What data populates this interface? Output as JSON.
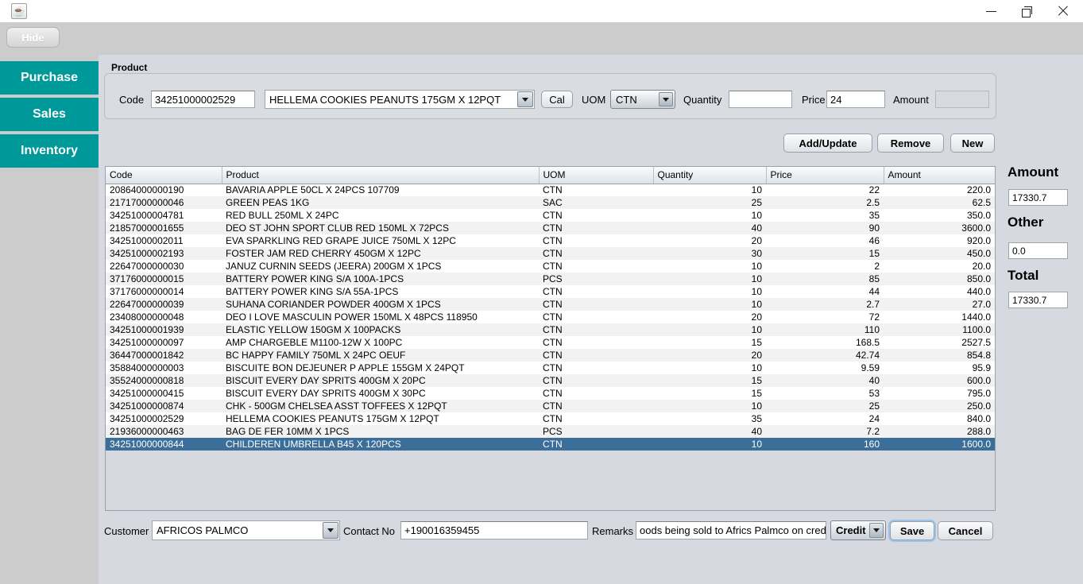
{
  "window": {
    "app_icon": "java-coffee-icon",
    "minimize": "minimize-icon",
    "maximize": "maximize-icon",
    "close": "close-icon"
  },
  "toolbar": {
    "hide_label": "Hide"
  },
  "sidebar": {
    "items": [
      {
        "label": "Purchase"
      },
      {
        "label": "Sales"
      },
      {
        "label": "Inventory"
      }
    ]
  },
  "product_panel": {
    "title": "Product",
    "code_label": "Code",
    "code_value": "34251000002529",
    "product_value": "HELLEMA COOKIES PEANUTS 175GM X 12PQT",
    "cal_label": "Cal",
    "uom_label": "UOM",
    "uom_value": "CTN",
    "quantity_label": "Quantity",
    "quantity_value": "",
    "price_label": "Price",
    "price_value": "24",
    "amount_label": "Amount",
    "amount_value": ""
  },
  "actions": {
    "add_update": "Add/Update",
    "remove": "Remove",
    "new": "New"
  },
  "table": {
    "columns": [
      "Code",
      "Product",
      "UOM",
      "Quantity",
      "Price",
      "Amount"
    ],
    "rows": [
      [
        "20864000000190",
        "BAVARIA APPLE 50CL X 24PCS 107709",
        "CTN",
        "10",
        "22",
        "220.0"
      ],
      [
        "21717000000046",
        "GREEN PEAS 1KG",
        "SAC",
        "25",
        "2.5",
        "62.5"
      ],
      [
        "34251000004781",
        "RED BULL 250ML X 24PC",
        "CTN",
        "10",
        "35",
        "350.0"
      ],
      [
        "21857000001655",
        "DEO ST JOHN SPORT CLUB RED 150ML X 72PCS",
        "CTN",
        "40",
        "90",
        "3600.0"
      ],
      [
        "34251000002011",
        "EVA SPARKLING RED GRAPE JUICE 750ML X 12PC",
        "CTN",
        "20",
        "46",
        "920.0"
      ],
      [
        "34251000002193",
        "FOSTER JAM RED CHERRY 450GM X 12PC",
        "CTN",
        "30",
        "15",
        "450.0"
      ],
      [
        "22647000000030",
        "JANUZ CURNIN SEEDS (JEERA) 200GM X 1PCS",
        "CTN",
        "10",
        "2",
        "20.0"
      ],
      [
        "37176000000015",
        "BATTERY POWER KING S/A 100A-1PCS",
        "PCS",
        "10",
        "85",
        "850.0"
      ],
      [
        "37176000000014",
        "BATTERY POWER KING S/A 55A-1PCS",
        "CTN",
        "10",
        "44",
        "440.0"
      ],
      [
        "22647000000039",
        "SUHANA CORIANDER POWDER 400GM X 1PCS",
        "CTN",
        "10",
        "2.7",
        "27.0"
      ],
      [
        "23408000000048",
        "DEO I LOVE MASCULIN POWER 150ML X 48PCS 118950",
        "CTN",
        "20",
        "72",
        "1440.0"
      ],
      [
        "34251000001939",
        "ELASTIC YELLOW 150GM X 100PACKS",
        "CTN",
        "10",
        "110",
        "1100.0"
      ],
      [
        "34251000000097",
        "AMP CHARGEBLE M1100-12W X 100PC",
        "CTN",
        "15",
        "168.5",
        "2527.5"
      ],
      [
        "36447000001842",
        "BC HAPPY FAMILY 750ML X 24PC OEUF",
        "CTN",
        "20",
        "42.74",
        "854.8"
      ],
      [
        "35884000000003",
        "BISCUITE BON DEJEUNER P APPLE 155GM X 24PQT",
        "CTN",
        "10",
        "9.59",
        "95.9"
      ],
      [
        "35524000000818",
        "BISCUIT EVERY DAY SPRITS 400GM X 20PC",
        "CTN",
        "15",
        "40",
        "600.0"
      ],
      [
        "34251000000415",
        "BISCUIT EVERY DAY SPRITS 400GM X 30PC",
        "CTN",
        "15",
        "53",
        "795.0"
      ],
      [
        "34251000000874",
        "CHK - 500GM CHELSEA ASST TOFFEES X 12PQT",
        "CTN",
        "10",
        "25",
        "250.0"
      ],
      [
        "34251000002529",
        "HELLEMA COOKIES PEANUTS 175GM X 12PQT",
        "CTN",
        "35",
        "24",
        "840.0"
      ],
      [
        "21936000000463",
        "BAG DE FER 10MM X 1PCS",
        "PCS",
        "40",
        "7.2",
        "288.0"
      ],
      [
        "34251000000844",
        "CHILDEREN UMBRELLA B45 X 120PCS",
        "CTN",
        "10",
        "160",
        "1600.0"
      ]
    ],
    "selected_row_index": 20
  },
  "totals": {
    "amount_label": "Amount",
    "amount_value": "17330.7",
    "other_label": "Other",
    "other_value": "0.0",
    "total_label": "Total",
    "total_value": "17330.7"
  },
  "footer": {
    "customer_label": "Customer",
    "customer_value": "AFRICOS PALMCO",
    "contact_label": "Contact No",
    "contact_value": "+190016359455",
    "remarks_label": "Remarks",
    "remarks_value": "oods being sold to Africs Palmco on credit",
    "payment_value": "Credit",
    "save_label": "Save",
    "cancel_label": "Cancel"
  },
  "colors": {
    "nav_teal": "#009999",
    "selection_blue": "#3b6e99",
    "panel_bg": "#d6dae0",
    "toolbar_gray": "#cccccc"
  }
}
